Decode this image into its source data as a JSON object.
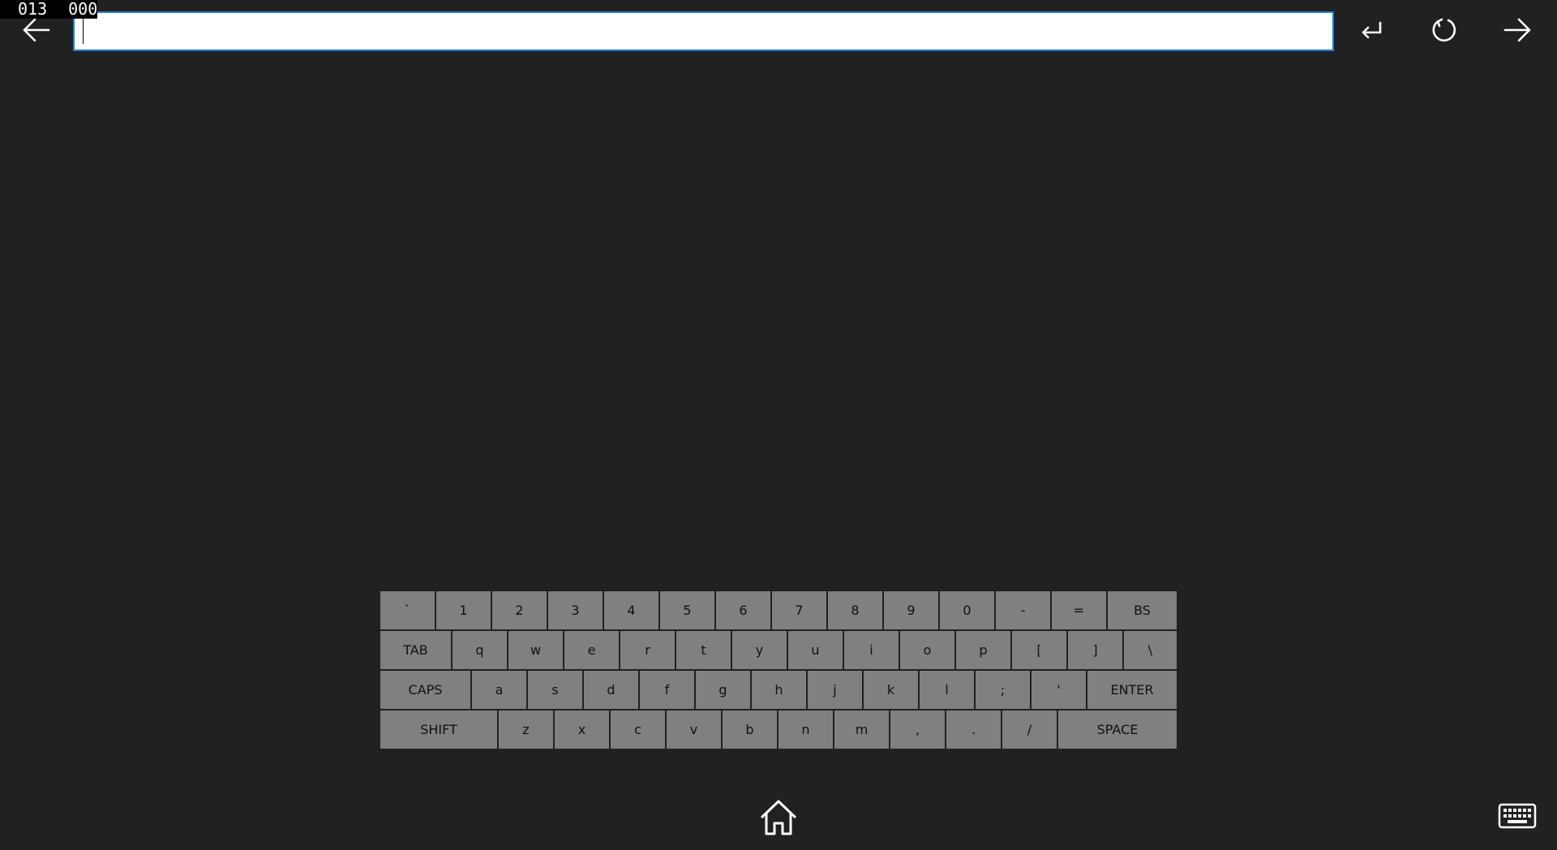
{
  "counter": {
    "left": "013",
    "right": "000"
  },
  "toolbar": {
    "back_icon": "arrow-left-icon",
    "enter_icon": "return-icon",
    "reload_icon": "reload-icon",
    "forward_icon": "arrow-right-icon",
    "url_value": "",
    "url_placeholder": ""
  },
  "keyboard": {
    "rows": [
      [
        {
          "label": "`",
          "w": 1
        },
        {
          "label": "1",
          "w": 1
        },
        {
          "label": "2",
          "w": 1
        },
        {
          "label": "3",
          "w": 1
        },
        {
          "label": "4",
          "w": 1
        },
        {
          "label": "5",
          "w": 1
        },
        {
          "label": "6",
          "w": 1
        },
        {
          "label": "7",
          "w": 1
        },
        {
          "label": "8",
          "w": 1
        },
        {
          "label": "9",
          "w": 1
        },
        {
          "label": "0",
          "w": 1
        },
        {
          "label": "-",
          "w": 1
        },
        {
          "label": "=",
          "w": 1
        },
        {
          "label": "BS",
          "w": 1.3
        }
      ],
      [
        {
          "label": "TAB",
          "w": 1.3
        },
        {
          "label": "q",
          "w": 1
        },
        {
          "label": "w",
          "w": 1
        },
        {
          "label": "e",
          "w": 1
        },
        {
          "label": "r",
          "w": 1
        },
        {
          "label": "t",
          "w": 1
        },
        {
          "label": "y",
          "w": 1
        },
        {
          "label": "u",
          "w": 1
        },
        {
          "label": "i",
          "w": 1
        },
        {
          "label": "o",
          "w": 1
        },
        {
          "label": "p",
          "w": 1
        },
        {
          "label": "[",
          "w": 1
        },
        {
          "label": "]",
          "w": 1
        },
        {
          "label": "\\",
          "w": 1
        }
      ],
      [
        {
          "label": "CAPS",
          "w": 1.65
        },
        {
          "label": "a",
          "w": 1
        },
        {
          "label": "s",
          "w": 1
        },
        {
          "label": "d",
          "w": 1
        },
        {
          "label": "f",
          "w": 1
        },
        {
          "label": "g",
          "w": 1
        },
        {
          "label": "h",
          "w": 1
        },
        {
          "label": "j",
          "w": 1
        },
        {
          "label": "k",
          "w": 1
        },
        {
          "label": "l",
          "w": 1
        },
        {
          "label": ";",
          "w": 1
        },
        {
          "label": "'",
          "w": 1
        },
        {
          "label": "ENTER",
          "w": 1.65
        }
      ],
      [
        {
          "label": "SHIFT",
          "w": 2.15
        },
        {
          "label": "z",
          "w": 1
        },
        {
          "label": "x",
          "w": 1
        },
        {
          "label": "c",
          "w": 1
        },
        {
          "label": "v",
          "w": 1
        },
        {
          "label": "b",
          "w": 1
        },
        {
          "label": "n",
          "w": 1
        },
        {
          "label": "m",
          "w": 1
        },
        {
          "label": ",",
          "w": 1
        },
        {
          "label": ".",
          "w": 1
        },
        {
          "label": "/",
          "w": 1
        },
        {
          "label": "SPACE",
          "w": 2.15
        }
      ]
    ]
  },
  "bottom": {
    "home_icon": "home-icon",
    "keyboard_icon": "keyboard-icon"
  }
}
